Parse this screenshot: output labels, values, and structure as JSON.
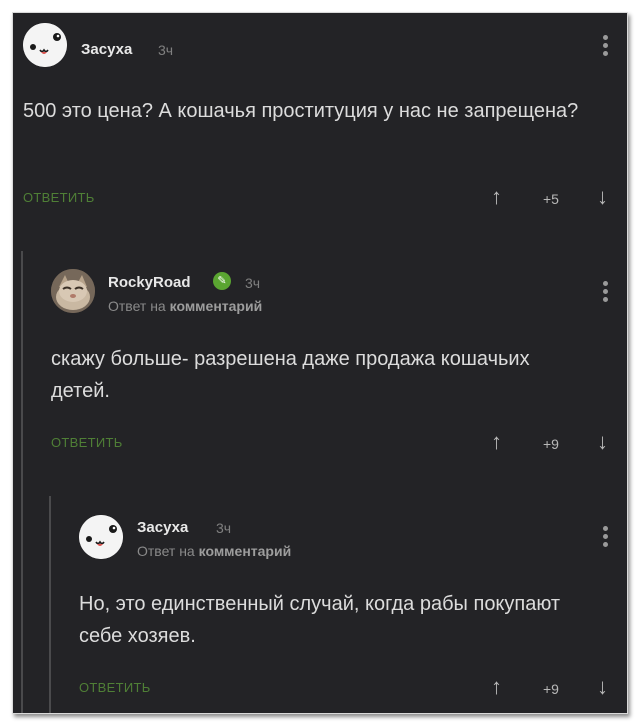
{
  "comments": [
    {
      "author": "Засуха",
      "time": "3ч",
      "text": "500 это цена? А кошачья проституция у нас не запрещена?",
      "reply_label": "ОТВЕТИТЬ",
      "rating": "+5",
      "avatar_icon": "smiley-face-avatar"
    },
    {
      "author": "RockyRoad",
      "time": "3ч",
      "reply_prefix": "Ответ на",
      "reply_target": "комментарий",
      "text": "скажу больше- разрешена даже продажа кошачьих детей.",
      "reply_label": "ОТВЕТИТЬ",
      "rating": "+9",
      "badge_icon": "pencil-icon",
      "avatar_icon": "cat-photo-avatar"
    },
    {
      "author": "Засуха",
      "time": "3ч",
      "reply_prefix": "Ответ на",
      "reply_target": "комментарий",
      "text": "Но, это единственный случай, когда рабы покупают себе хозяев.",
      "reply_label": "ОТВЕТИТЬ",
      "rating": "+9",
      "avatar_icon": "smiley-face-avatar"
    }
  ],
  "colors": {
    "background": "#232326",
    "reply_link": "#4f7f36",
    "badge": "#5aa531"
  }
}
